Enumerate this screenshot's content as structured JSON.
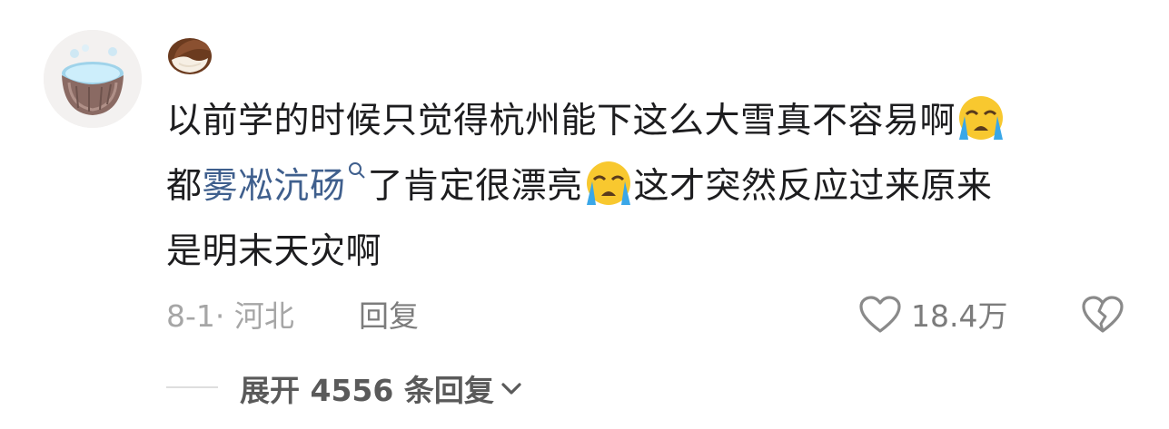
{
  "comment": {
    "line1": "以前学的时候只觉得杭州能下这么大雪真不容易啊",
    "line2_prefix": "都",
    "link": "雾凇沆砀",
    "line2_mid": "了肯定很漂亮",
    "line2_suffix": "这才突然反应过来原来",
    "line3": "是明末天灾啊",
    "emoji": "crying-face-emoji"
  },
  "meta": {
    "date_location": "8-1· 河北",
    "reply_label": "回复",
    "like_count": "18.4万"
  },
  "replies": {
    "expand_label": "展开 4556 条回复"
  },
  "icons": {
    "avatar": "coconut-avatar",
    "username": "coconut-emoji",
    "like": "heart-outline-icon",
    "dislike": "broken-heart-icon",
    "search": "search-icon",
    "expand": "chevron-down-icon"
  },
  "colors": {
    "link": "#3f5f8d",
    "text": "#1d1d1f",
    "meta": "#a6a6a6"
  }
}
